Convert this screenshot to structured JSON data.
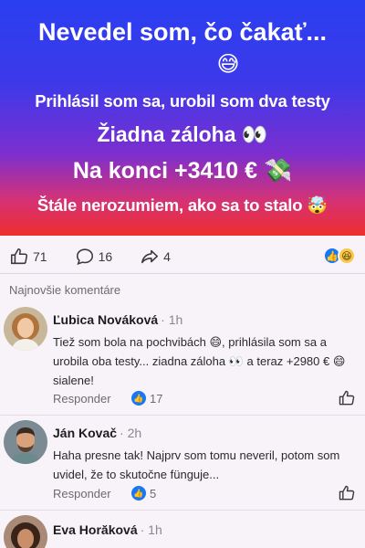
{
  "hero": {
    "line1": "Nevedel som, čo čakať...",
    "line1_emoji": "😅",
    "line2": "Prihlásil som sa, urobil som dva testy",
    "line3": "Žiadna záloha",
    "line3_emoji": "👀",
    "line4": "Na konci +3410 €",
    "line4_emoji": "💸",
    "line5": "Štále nerozumiem, ako sa to stalo",
    "line5_emoji": "🤯"
  },
  "actions": {
    "likes": "71",
    "comments": "16",
    "shares": "4"
  },
  "comments_section": {
    "title": "Najnovšie komentáre",
    "reply_label": "Responder",
    "items": [
      {
        "name": "Ľubica Nováková",
        "time": "· 1h",
        "text": "Tiež som bola na pochvibách 😄, prihlásila som sa a urobila oba testy... ziadna záloha 👀 a teraz +2980 € 😄 sialene!",
        "likes": "17"
      },
      {
        "name": "Ján Kovač",
        "time": "· 2h",
        "text": "Haha presne tak! Najprv som tomu neveril, potom som uvidel, že to skutočne fünguje...",
        "likes": "5"
      },
      {
        "name": "Eva Horăková",
        "time": "· 1h",
        "text": ""
      }
    ]
  },
  "colors": {
    "hero_top": "#2a3ff0",
    "hero_bottom": "#ee2d2d",
    "like_blue": "#1877f2",
    "background": "#f7f3f9"
  }
}
